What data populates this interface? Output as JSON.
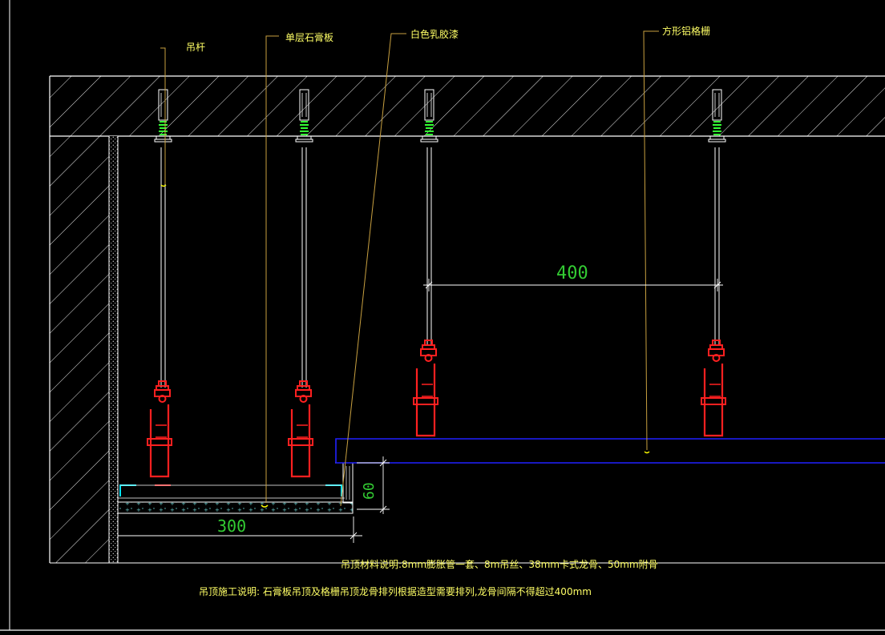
{
  "labels": {
    "hanger_rod": "吊杆",
    "gypsum_board": "单层石膏板",
    "latex_paint": "白色乳胶漆",
    "aluminum_grille": "方形铝格栅"
  },
  "dimensions": {
    "rod_spacing": "400",
    "drop_height": "60",
    "board_width": "300"
  },
  "notes": {
    "materials": "吊顶材料说明:8mm膨胀管一套、8m吊丝、38mm卡式龙骨、50mm附骨",
    "construction": "吊顶施工说明: 石膏板吊顶及格栅吊顶龙骨排列根据造型需要排列,龙骨间隔不得超过400mm"
  },
  "colors": {
    "background": "#000000",
    "linework": "#ffffff",
    "hanger_bracket": "#ff2020",
    "spring": "#33ff33",
    "leader": "#c8a040",
    "label_text": "#ffff66",
    "dimension_text": "#33cc33",
    "grille_outline": "#2020ff",
    "board_edge": "#00e5ff"
  }
}
